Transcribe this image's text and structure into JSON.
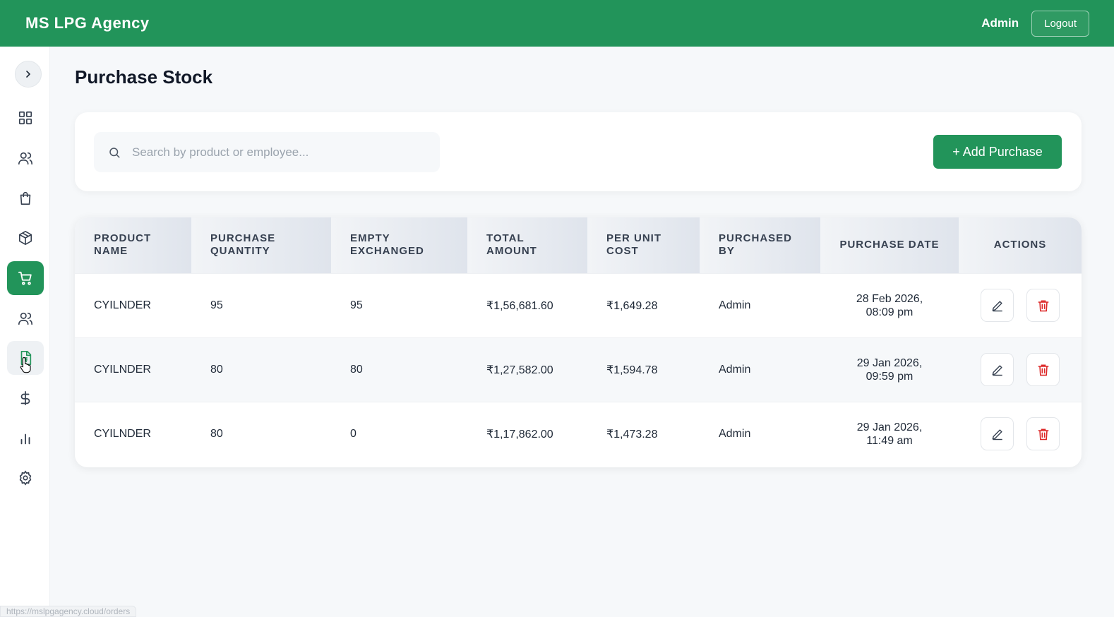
{
  "header": {
    "brand": "MS LPG Agency",
    "user": "Admin",
    "logout_label": "Logout"
  },
  "sidebar": {
    "items": [
      {
        "name": "dashboard",
        "icon": "grid-icon"
      },
      {
        "name": "customers",
        "icon": "users-icon"
      },
      {
        "name": "orders",
        "icon": "shopping-bag-icon"
      },
      {
        "name": "products",
        "icon": "box-icon"
      },
      {
        "name": "purchase",
        "icon": "cart-icon",
        "active": true
      },
      {
        "name": "employees",
        "icon": "users-icon"
      },
      {
        "name": "invoices",
        "icon": "document-icon"
      },
      {
        "name": "payments",
        "icon": "dollar-icon"
      },
      {
        "name": "reports",
        "icon": "bar-chart-icon"
      },
      {
        "name": "settings",
        "icon": "gear-icon"
      }
    ]
  },
  "page": {
    "title": "Purchase Stock"
  },
  "search": {
    "placeholder": "Search by product or employee...",
    "value": ""
  },
  "add_button": "+ Add Purchase",
  "table": {
    "columns": [
      "PRODUCT NAME",
      "PURCHASE QUANTITY",
      "EMPTY EXCHANGED",
      "TOTAL AMOUNT",
      "PER UNIT COST",
      "PURCHASED BY",
      "PURCHASE DATE",
      "ACTIONS"
    ],
    "rows": [
      {
        "product": "CYILNDER",
        "quantity": "95",
        "empty": "95",
        "total": "₹1,56,681.60",
        "unit_cost": "₹1,649.28",
        "by": "Admin",
        "date": "28 Feb 2026,",
        "time": "08:09 pm"
      },
      {
        "product": "CYILNDER",
        "quantity": "80",
        "empty": "80",
        "total": "₹1,27,582.00",
        "unit_cost": "₹1,594.78",
        "by": "Admin",
        "date": "29 Jan 2026,",
        "time": "09:59 pm"
      },
      {
        "product": "CYILNDER",
        "quantity": "80",
        "empty": "0",
        "total": "₹1,17,862.00",
        "unit_cost": "₹1,473.28",
        "by": "Admin",
        "date": "29 Jan 2026,",
        "time": "11:49 am"
      }
    ]
  },
  "status_url": "https://mslpgagency.cloud/orders",
  "colors": {
    "primary": "#22945a",
    "danger": "#dc2626",
    "background": "#f6f8fa"
  }
}
